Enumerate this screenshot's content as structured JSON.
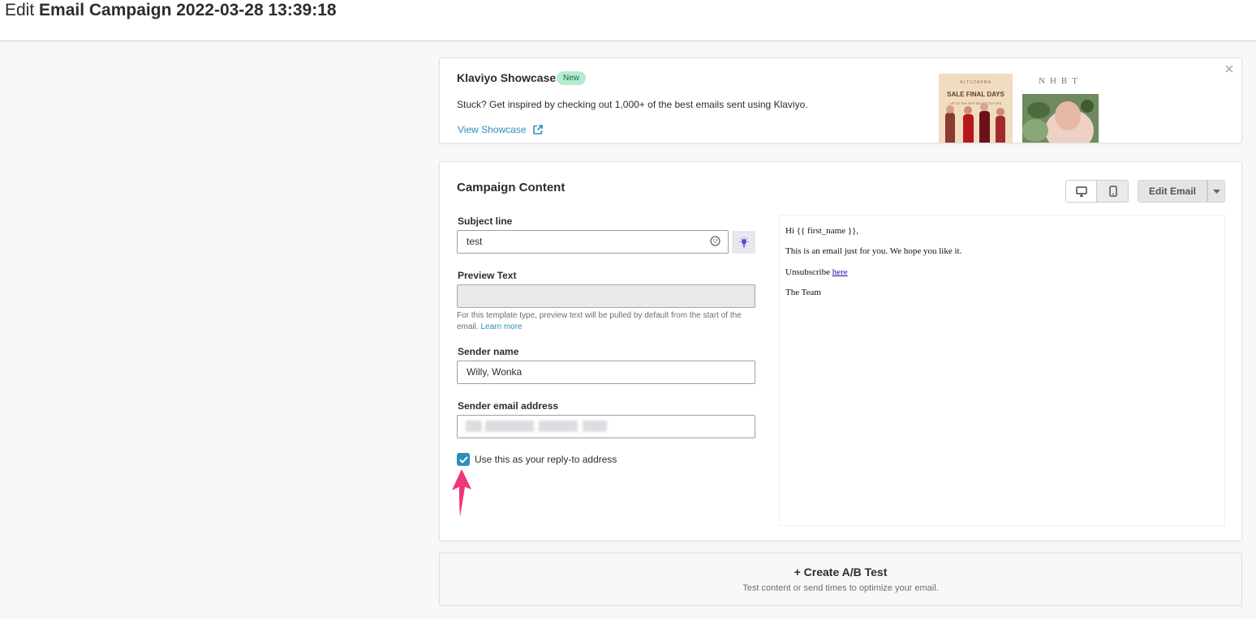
{
  "header": {
    "title_prefix": "Edit",
    "title_name": "Email Campaign 2022-03-28 13:39:18"
  },
  "showcase": {
    "title": "Klaviyo Showcase",
    "badge": "New",
    "description": "Stuck? Get inspired by checking out 1,000+ of the best emails sent using Klaviyo.",
    "link_label": "View Showcase",
    "thumb1": {
      "brand": "ALTUZARRA",
      "headline": "SALE FINAL DAYS",
      "subline": "UP TO 70% OFF SELECT STYLES"
    },
    "thumb2": {
      "logo": "NHBT"
    },
    "icons": [
      "external-link-icon",
      "close-icon"
    ]
  },
  "campaign": {
    "title": "Campaign Content",
    "edit_email_label": "Edit Email",
    "subject": {
      "label": "Subject line",
      "value": "test"
    },
    "preview_text": {
      "label": "Preview Text",
      "value": "",
      "helper": "For this template type, preview text will be pulled by default from the start of the email.",
      "helper_link": "Learn more"
    },
    "sender_name": {
      "label": "Sender name",
      "value": "Willy, Wonka"
    },
    "sender_email": {
      "label": "Sender email address",
      "value": ""
    },
    "reply_to": {
      "label": "Use this as your reply-to address",
      "checked": true
    },
    "email_preview": {
      "greeting": "Hi {{ first_name }},",
      "body": "This is an email just for you. We hope you like it.",
      "unsubscribe_prefix": "Unsubscribe",
      "unsubscribe_link": "here",
      "signoff": "The Team"
    }
  },
  "ab_test": {
    "title": "+ Create A/B Test",
    "subtitle": "Test content or send times to optimize your email."
  },
  "colors": {
    "accent": "#2b8fb8",
    "badge_bg": "#b3ecd0",
    "annotation_arrow": "#f0357a"
  }
}
